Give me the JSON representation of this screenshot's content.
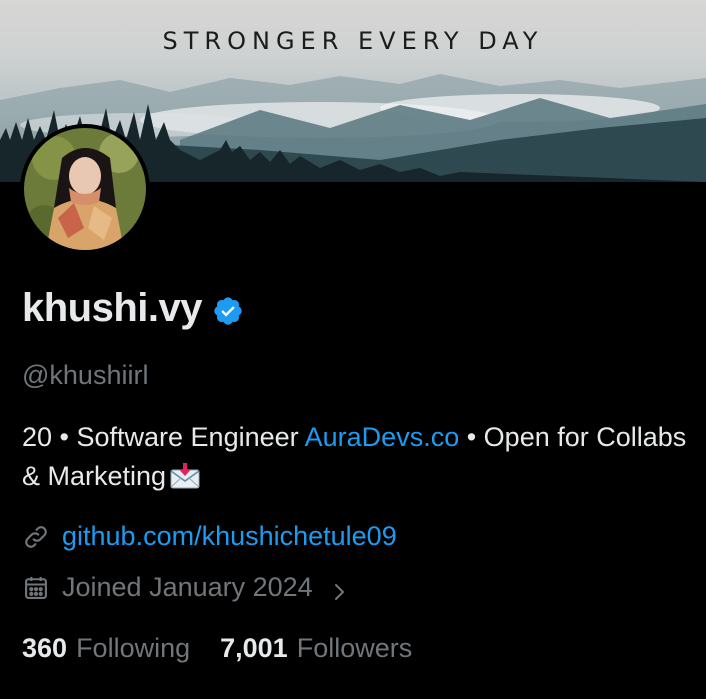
{
  "banner": {
    "title": "STRONGER EVERY DAY"
  },
  "profile": {
    "display_name": "khushi.vy",
    "verified": true,
    "handle": "@khushiirl",
    "bio": {
      "prefix": "20 • Software Engineer ",
      "company_link": "AuraDevs.co",
      "suffix": " • Open for Collabs & Marketing"
    },
    "website": "github.com/khushichetule09",
    "joined": "Joined January 2024",
    "following_count": "360",
    "following_label": "Following",
    "followers_count": "7,001",
    "followers_label": "Followers"
  },
  "icons": {
    "verified": "verified-badge-icon",
    "envelope": "envelope-with-arrow-icon",
    "link": "link-icon",
    "calendar": "calendar-icon",
    "chevron": "chevron-right-icon"
  },
  "colors": {
    "background": "#000000",
    "primary_text": "#e7e9ea",
    "secondary_text": "#71767b",
    "accent": "#1d9bf0"
  }
}
